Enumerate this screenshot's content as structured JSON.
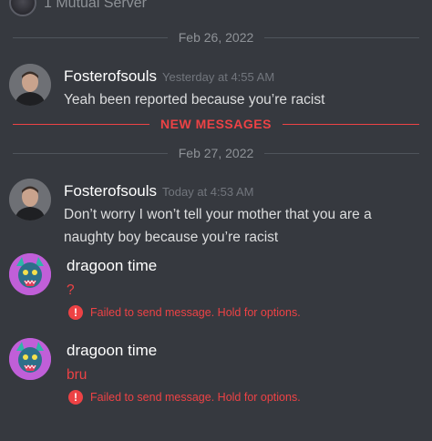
{
  "header": {
    "mutual_servers": "1 Mutual Server"
  },
  "dividers": {
    "date1": "Feb 26, 2022",
    "new_messages": "NEW MESSAGES",
    "date2": "Feb 27, 2022"
  },
  "messages": [
    {
      "author": "Fosterofsouls",
      "timestamp": "Yesterday at 4:55 AM",
      "text": "Yeah been reported because you’re racist"
    },
    {
      "author": "Fosterofsouls",
      "timestamp": "Today at 4:53 AM",
      "text_line1": "Don’t worry I won’t tell your mother that you are a",
      "text_line2": "naughty boy because you’re racist"
    },
    {
      "author": "dragoon time",
      "text": "?",
      "error": "Failed to send message. Hold for options."
    },
    {
      "author": "dragoon time",
      "text": "bru",
      "error": "Failed to send message. Hold for options."
    }
  ],
  "colors": {
    "background": "#36393f",
    "error_red": "#ed4245",
    "muted_text": "#8e9297"
  },
  "icons": {
    "error": "exclamation-circle-icon"
  }
}
